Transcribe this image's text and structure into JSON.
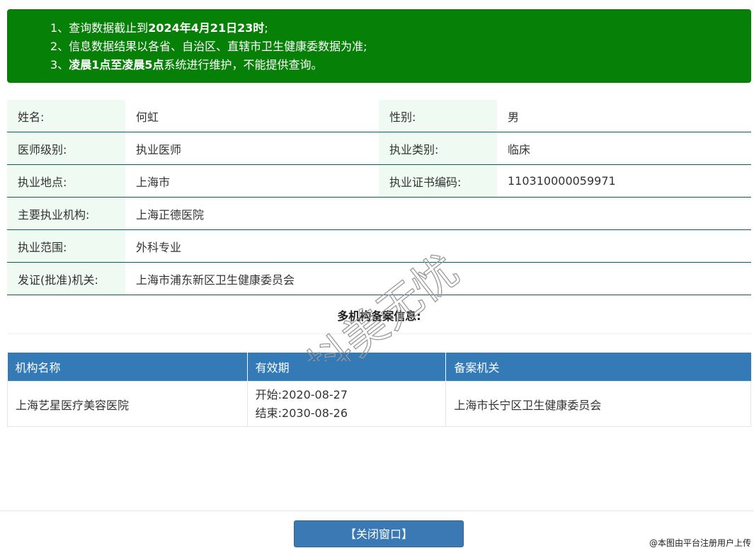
{
  "notice": {
    "line1_prefix": "1、查询数据截止到",
    "line1_bold": "2024年4月21日23时",
    "line1_suffix": ";",
    "line2": "2、信息数据结果以各省、自治区、直辖市卫生健康委数据为准;",
    "line3_prefix": "3、",
    "line3_bold": "凌晨1点至凌晨5点",
    "line3_suffix": "系统进行维护，不能提供查询。"
  },
  "info": {
    "name_label": "姓名:",
    "name_value": "何虹",
    "gender_label": "性别:",
    "gender_value": "男",
    "level_label": "医师级别:",
    "level_value": "执业医师",
    "category_label": "执业类别:",
    "category_value": "临床",
    "location_label": "执业地点:",
    "location_value": "上海市",
    "cert_label": "执业证书编码:",
    "cert_value": "110310000059971",
    "org_label": "主要执业机构:",
    "org_value": "上海正德医院",
    "scope_label": "执业范围:",
    "scope_value": "外科专业",
    "issuer_label": "发证(批准)机关:",
    "issuer_value": "上海市浦东新区卫生健康委员会"
  },
  "multi_title": "多机构备案信息:",
  "orgs_table": {
    "headers": [
      "机构名称",
      "有效期",
      "备案机关"
    ],
    "rows": [
      {
        "name": "上海艺星医疗美容医院",
        "start": "开始:2020-08-27",
        "end": "结束:2030-08-26",
        "authority": "上海市长宁区卫生健康委员会"
      }
    ]
  },
  "close_button": "【关闭窗口】",
  "watermark_text": "抖美无忧",
  "source_note": "@本图由平台注册用户上传",
  "colors": {
    "notice_bg": "#078007",
    "label_bg": "#eefaf2",
    "row_border": "#0e5d5a",
    "header_bg": "#337ab7",
    "button_bg": "#3a79b3"
  }
}
